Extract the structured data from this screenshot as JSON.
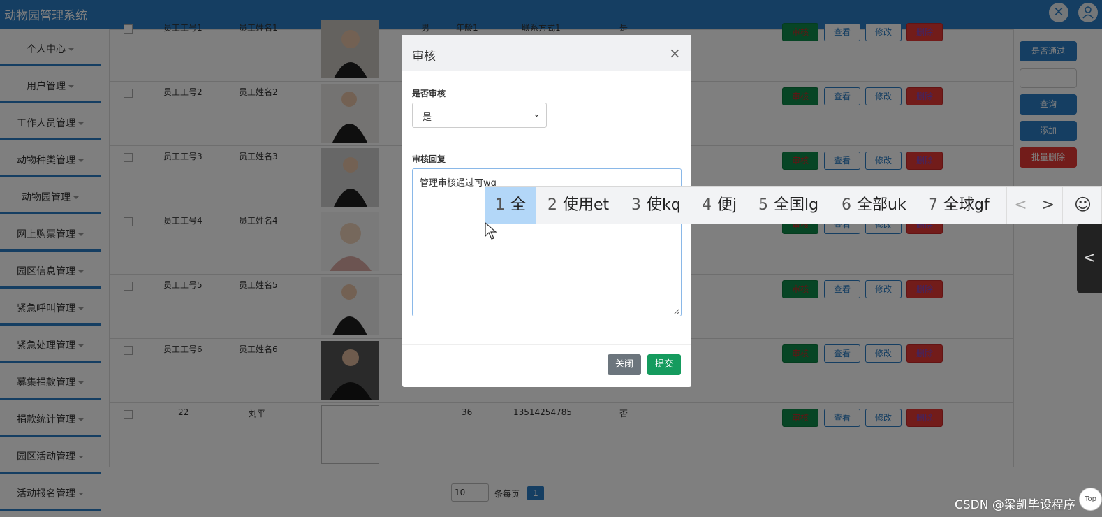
{
  "header": {
    "title": "动物园管理系统",
    "close_icon": "✕"
  },
  "sidebar": {
    "items": [
      {
        "label": "个人中心"
      },
      {
        "label": "用户管理"
      },
      {
        "label": "工作人员管理"
      },
      {
        "label": "动物种类管理"
      },
      {
        "label": "动物园管理"
      },
      {
        "label": "网上购票管理"
      },
      {
        "label": "园区信息管理"
      },
      {
        "label": "紧急呼叫管理"
      },
      {
        "label": "紧急处理管理"
      },
      {
        "label": "募集捐款管理"
      },
      {
        "label": "捐款统计管理"
      },
      {
        "label": "园区活动管理"
      },
      {
        "label": "活动报名管理"
      }
    ]
  },
  "table": {
    "rows": [
      {
        "id": "员工工号1",
        "name": "员工姓名1",
        "gender": "男",
        "age": "年龄1",
        "contact": "联系方式1",
        "passed": "是",
        "photo": "female"
      },
      {
        "id": "员工工号2",
        "name": "员工姓名2",
        "gender": "",
        "age": "",
        "contact": "",
        "passed": "",
        "photo": "female"
      },
      {
        "id": "员工工号3",
        "name": "员工姓名3",
        "gender": "",
        "age": "",
        "contact": "",
        "passed": "",
        "photo": "female"
      },
      {
        "id": "员工工号4",
        "name": "员工姓名4",
        "gender": "",
        "age": "",
        "contact": "",
        "passed": "",
        "photo": "female"
      },
      {
        "id": "员工工号5",
        "name": "员工姓名5",
        "gender": "",
        "age": "",
        "contact": "",
        "passed": "",
        "photo": "female"
      },
      {
        "id": "员工工号6",
        "name": "员工姓名6",
        "gender": "",
        "age": "",
        "contact": "",
        "passed": "",
        "photo": "male"
      },
      {
        "id": "22",
        "name": "刘平",
        "gender": "",
        "age": "36",
        "contact": "13514254785",
        "passed": "否",
        "photo": "empty"
      }
    ],
    "actions": {
      "audit": "审核",
      "view": "查看",
      "edit": "修改",
      "delete": "删除"
    }
  },
  "right_panel": {
    "is_passed_btn": "是否通过",
    "search_btn": "查询",
    "add_btn": "添加",
    "batch_delete_btn": "批量删除"
  },
  "modal": {
    "title": "审核",
    "close_icon": "×",
    "approve_label": "是否审核",
    "approve_value": "是",
    "reply_label": "审核回复",
    "reply_text": "管理审核通过可wq",
    "close_btn": "关闭",
    "submit_btn": "提交"
  },
  "ime": {
    "candidates": [
      {
        "num": "1",
        "text": "全"
      },
      {
        "num": "2",
        "text": "使用et"
      },
      {
        "num": "3",
        "text": "使kq"
      },
      {
        "num": "4",
        "text": "便j"
      },
      {
        "num": "5",
        "text": "全国lg"
      },
      {
        "num": "6",
        "text": "全部uk"
      },
      {
        "num": "7",
        "text": "全球gf"
      }
    ],
    "prev": "<",
    "next": ">",
    "emoji": "☺"
  },
  "pagination": {
    "page_size": "10",
    "page_size_label": "条每页",
    "current_page": "1"
  },
  "side_tab_icon": "<",
  "top_button": "Top",
  "watermark": "CSDN @梁凯毕设程序"
}
